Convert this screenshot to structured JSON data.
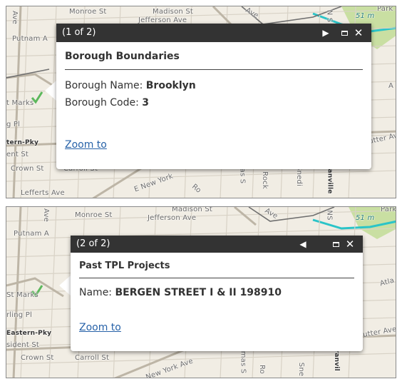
{
  "popup1": {
    "counter": "(1 of 2)",
    "next_icon": "play-triangle",
    "header": "Borough Boundaries",
    "fields": [
      {
        "label": "Borough Name: ",
        "value": "Brooklyn"
      },
      {
        "label": "Borough Code: ",
        "value": "3"
      }
    ],
    "zoom_label": "Zoom to"
  },
  "popup2": {
    "counter": "(2 of 2)",
    "prev_icon": "reverse-triangle",
    "header": "Past TPL Projects",
    "fields": [
      {
        "label": "Name: ",
        "value": "BERGEN STREET I & II 198910"
      }
    ],
    "zoom_label": "Zoom to"
  },
  "icons": {
    "maximize": "maximize-icon",
    "close": "close-icon"
  },
  "close_glyph": "✕",
  "map1_labels": {
    "monroe": "Monroe St",
    "madison": "Madison St",
    "jefferson": "Jefferson Ave",
    "putnam": "Putnam A",
    "ave_top": "Ave",
    "ave_v": "Ave",
    "ns": "N S",
    "rt51": "51 m",
    "park": "Park",
    "stmarks": "t Marks",
    "gpl": "g Pl",
    "eastern": "tern-Pky",
    "ent": "ent St",
    "crown": "Crown St",
    "carroll": "Carroll St",
    "lefferts": "Lefferts Ave",
    "newyork": "E New York",
    "ro": "Ro",
    "masS": "as S",
    "rock": "Rock",
    "snedi": "Snedi",
    "anville": "anville",
    "utter": "utter Av",
    "a_right": "A"
  },
  "map2_labels": {
    "monroe": "Monroe St",
    "madison": "Madison St",
    "jefferson": "Jefferson Ave",
    "putnam": "Putnam A",
    "ave_top": "Ave",
    "ave_v": "Ave",
    "ns": "NS",
    "rt51": "51 m",
    "park": "Park",
    "stmarks": "St Marks",
    "rling": "rling Pl",
    "eastern": "Eastern-Pky",
    "sident": "sident St",
    "crown": "Crown St",
    "carroll": "Carroll St",
    "newyork": "New York Ave",
    "mas": "mas S",
    "ro": "Ro",
    "sne": "Sne",
    "granvil": "Granvil",
    "utter": "utter Ave",
    "atla": "Atla"
  },
  "colors": {
    "titlebar": "#333333",
    "link": "#2762a8",
    "map_bg": "#f1ede4",
    "park_green": "#c9dfa2",
    "water_teal": "#2bc4c8",
    "marker_green": "#5cb85c"
  }
}
